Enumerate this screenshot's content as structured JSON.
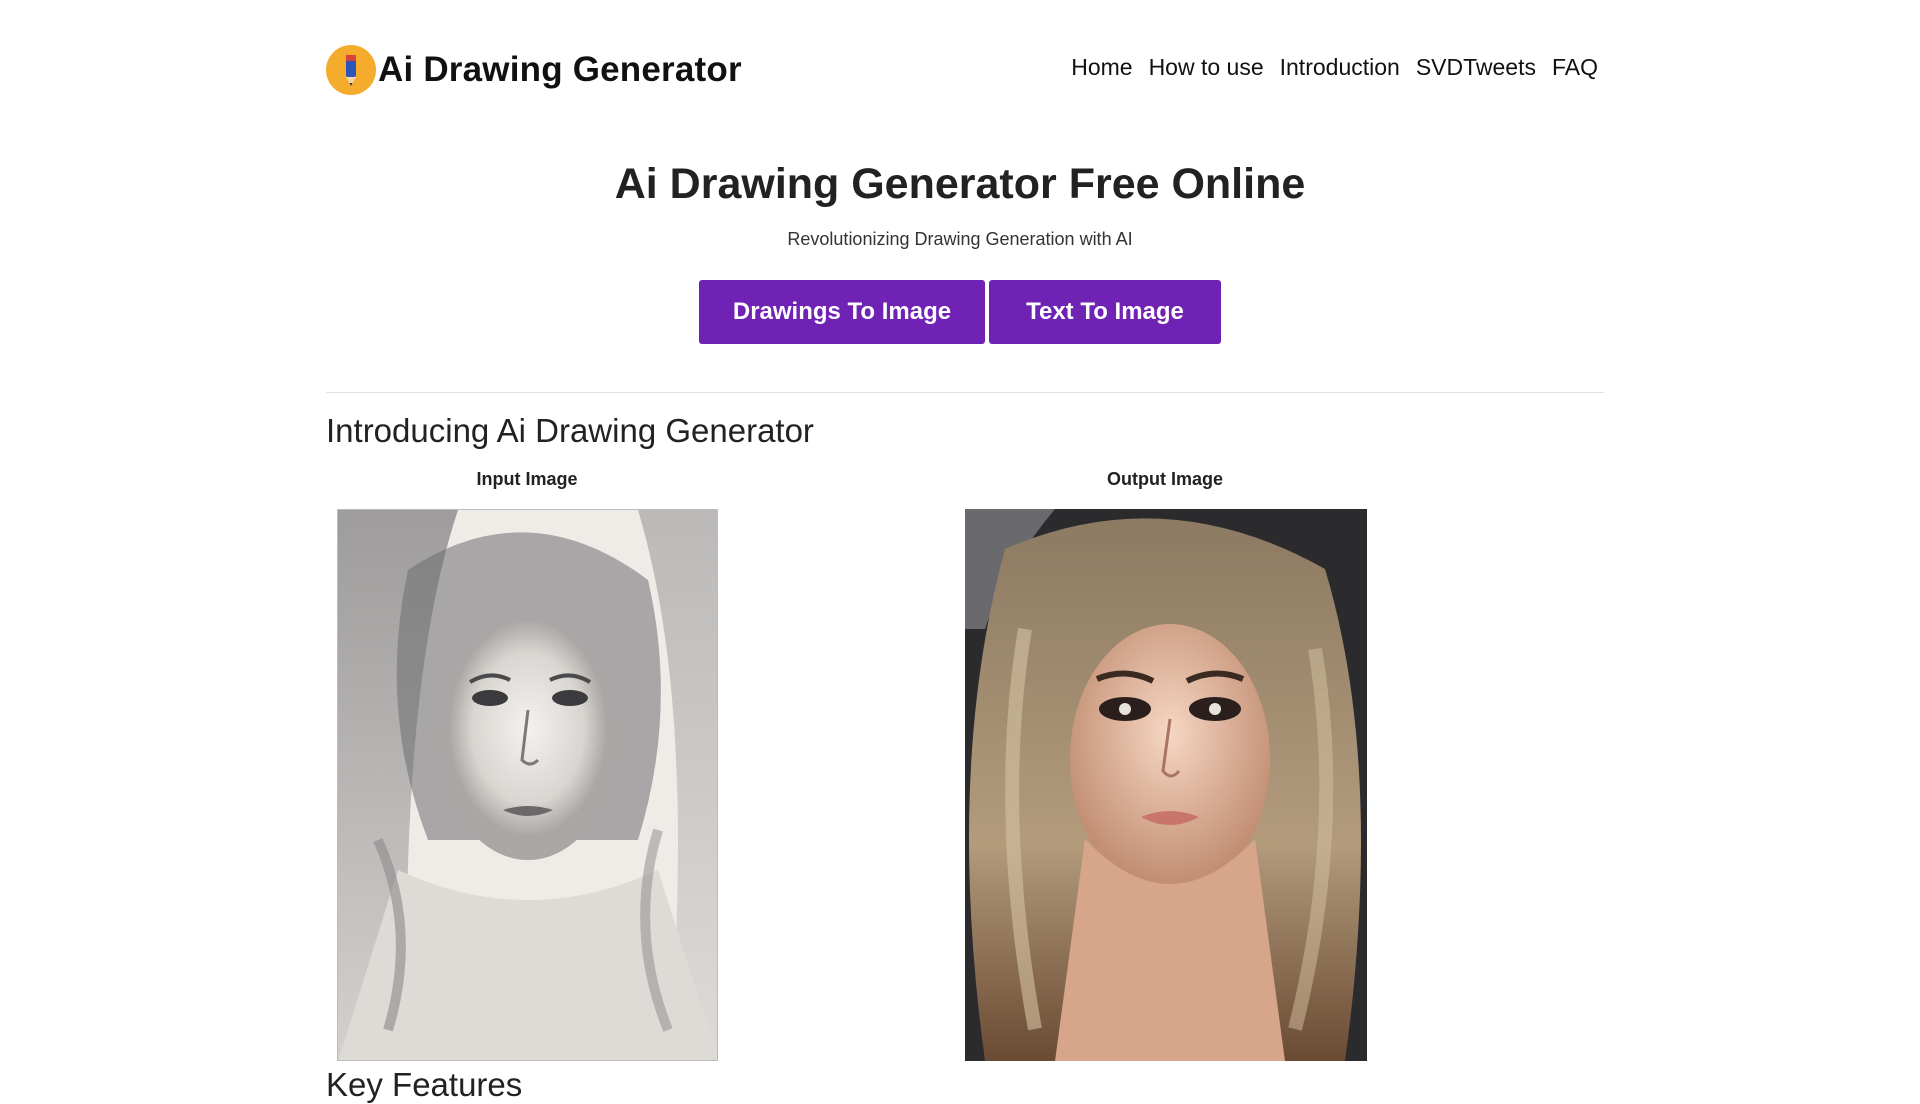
{
  "header": {
    "brand": "Ai Drawing Generator",
    "logo_icon": "pencil-icon",
    "nav": [
      "Home",
      "How to use",
      "Introduction",
      "SVDTweets",
      "FAQ"
    ]
  },
  "hero": {
    "title": "Ai Drawing Generator Free Online",
    "subtitle": "Revolutionizing Drawing Generation with AI",
    "buttons": [
      "Drawings To Image",
      "Text To Image"
    ]
  },
  "intro": {
    "title": "Introducing Ai Drawing Generator",
    "input_label": "Input Image",
    "output_label": "Output Image"
  },
  "next_section": {
    "title": "Key Features"
  },
  "colors": {
    "accent": "#6f22b3",
    "logo_bg": "#f5ac2d"
  }
}
